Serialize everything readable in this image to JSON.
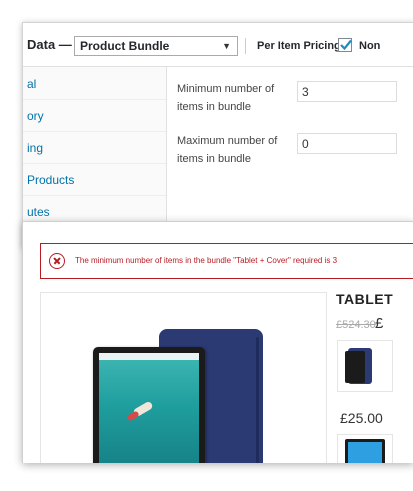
{
  "admin": {
    "product_data_label": "Data —",
    "product_type": "Product Bundle",
    "per_item_pricing_label": "Per Item Pricing:",
    "per_item_pricing_checked": true,
    "non_bundle_label": "Non",
    "sidebar": {
      "items": [
        {
          "label": "al"
        },
        {
          "label": "ory"
        },
        {
          "label": "ing"
        },
        {
          "label": " Products"
        },
        {
          "label": "utes"
        }
      ]
    },
    "min_items": {
      "label": "Minimum number of items in bundle",
      "value": "3"
    },
    "max_items": {
      "label": "Maximum number of items in bundle",
      "value": "0"
    }
  },
  "store": {
    "notice_text": "The minimum number of items in the bundle \"Tablet + Cover\" required is 3",
    "product_title": "TABLET",
    "old_price": "£524.30",
    "current_price_partial": "£",
    "option_price": "£25.00",
    "colors": {
      "error": "#b81c23",
      "link": "#0073aa"
    }
  }
}
